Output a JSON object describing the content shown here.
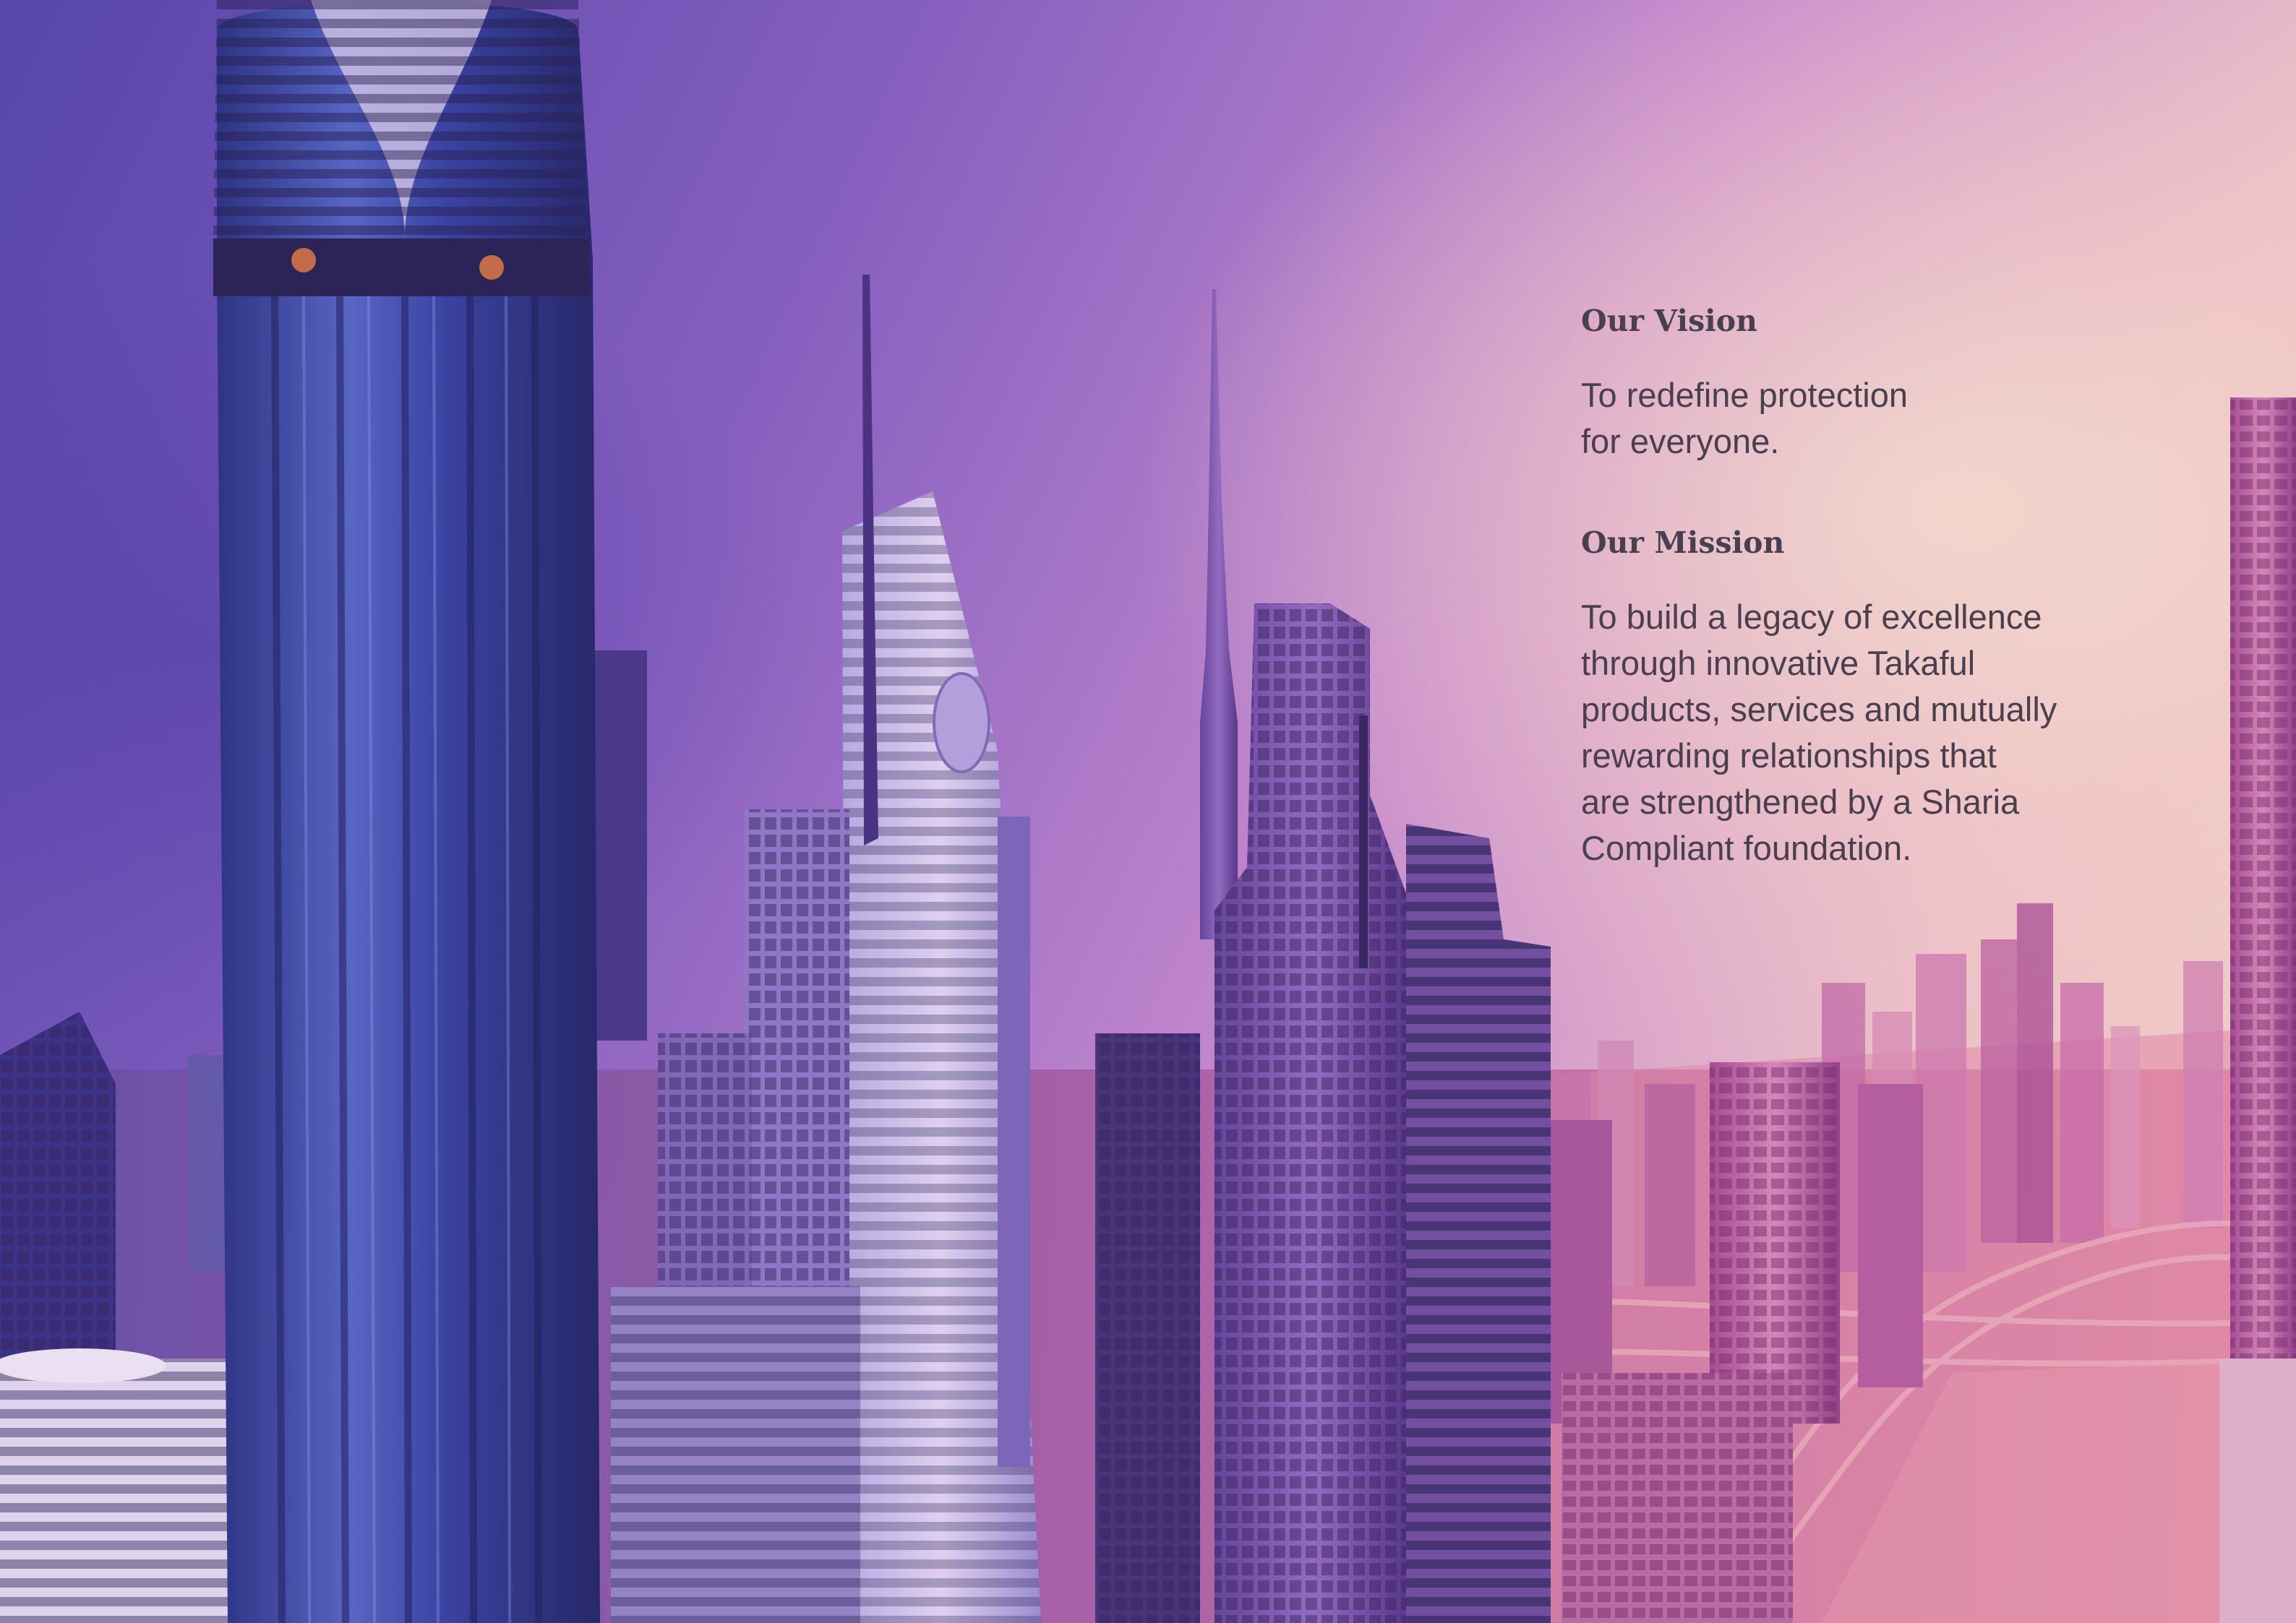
{
  "vision": {
    "heading": "Our Vision",
    "text": "To redefine protection\nfor everyone."
  },
  "mission": {
    "heading": "Our Mission",
    "text": "To build a legacy of excellence\nthrough innovative Takaful\nproducts, services and mutually\nrewarding relationships that\nare strengthened by a Sharia\nCompliant foundation."
  },
  "colors": {
    "text": "#4a3f4f",
    "sky_left": "#4a3fa8",
    "sky_right": "#fde3c2"
  }
}
